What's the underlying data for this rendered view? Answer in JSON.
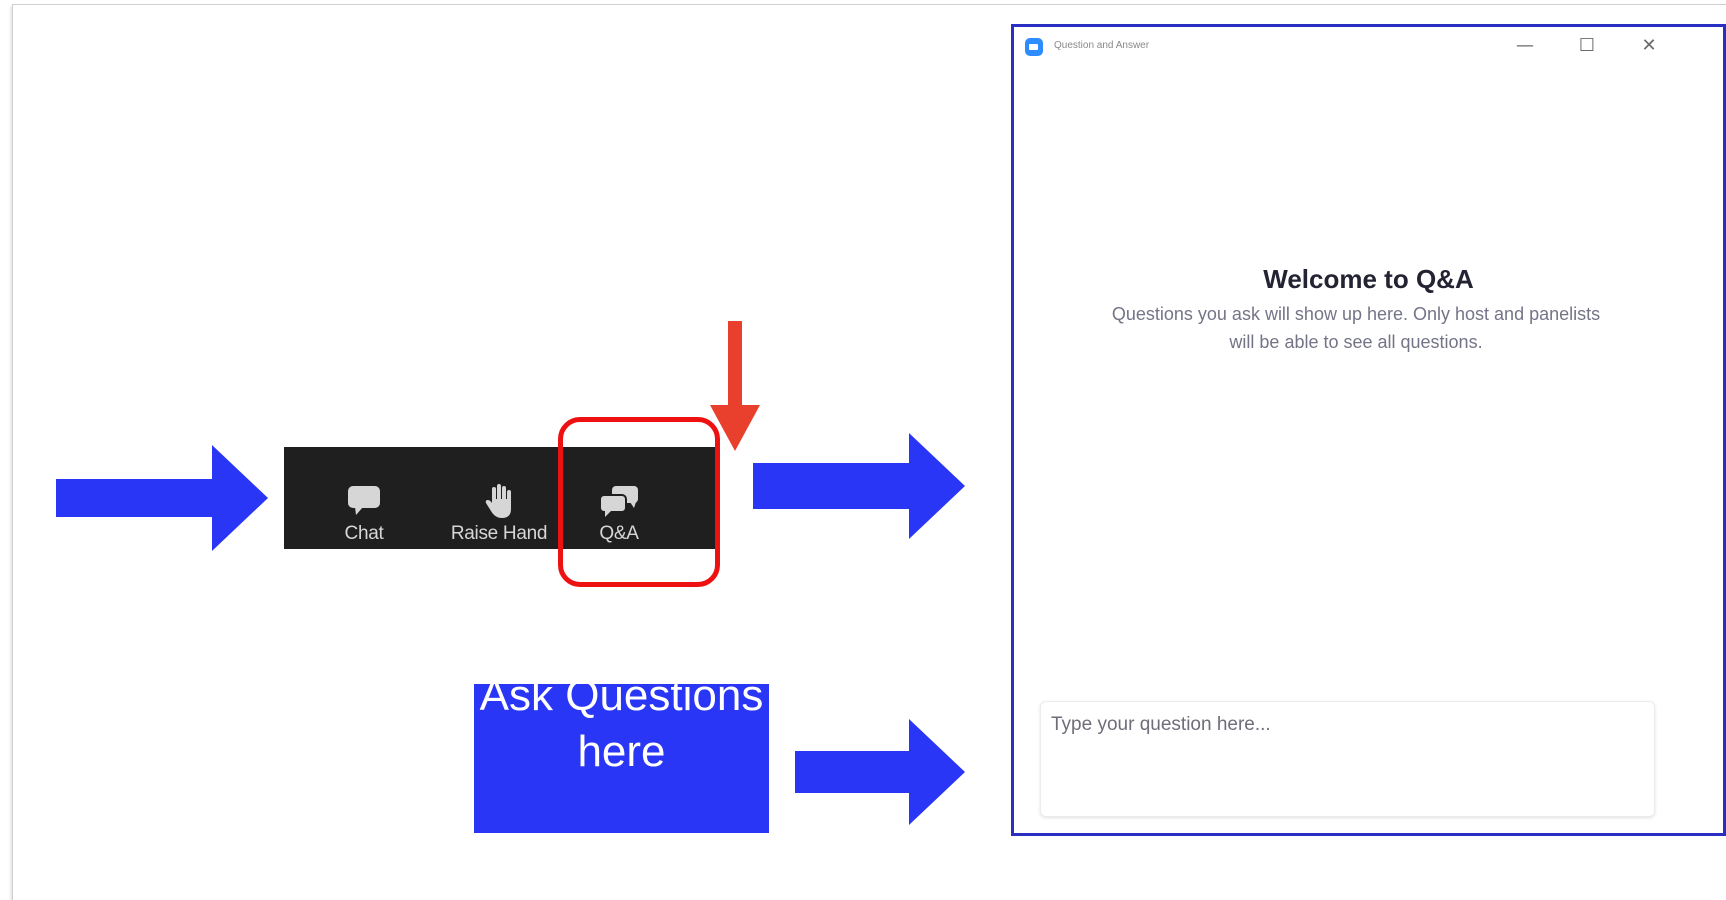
{
  "toolbar": {
    "items": [
      {
        "label": "Chat",
        "icon": "chat-bubble-icon"
      },
      {
        "label": "Raise Hand",
        "icon": "hand-icon"
      },
      {
        "label": "Q&A",
        "icon": "qa-bubbles-icon"
      }
    ]
  },
  "callout": {
    "label": "Ask Questions here"
  },
  "qa_window": {
    "title": "Question and Answer",
    "controls": {
      "minimize": "—",
      "maximize": "☐",
      "close": "✕"
    },
    "welcome_title": "Welcome to Q&A",
    "welcome_subtitle": "Questions you ask will show up here. Only host and panelists will be able to see all questions.",
    "input_placeholder": "Type your question here..."
  },
  "colors": {
    "arrow_blue": "#2a36f5",
    "arrow_red": "#e8402d",
    "highlight_red": "#ee1111",
    "toolbar_bg": "#1f1f1f",
    "window_border": "#2a2fc4"
  }
}
